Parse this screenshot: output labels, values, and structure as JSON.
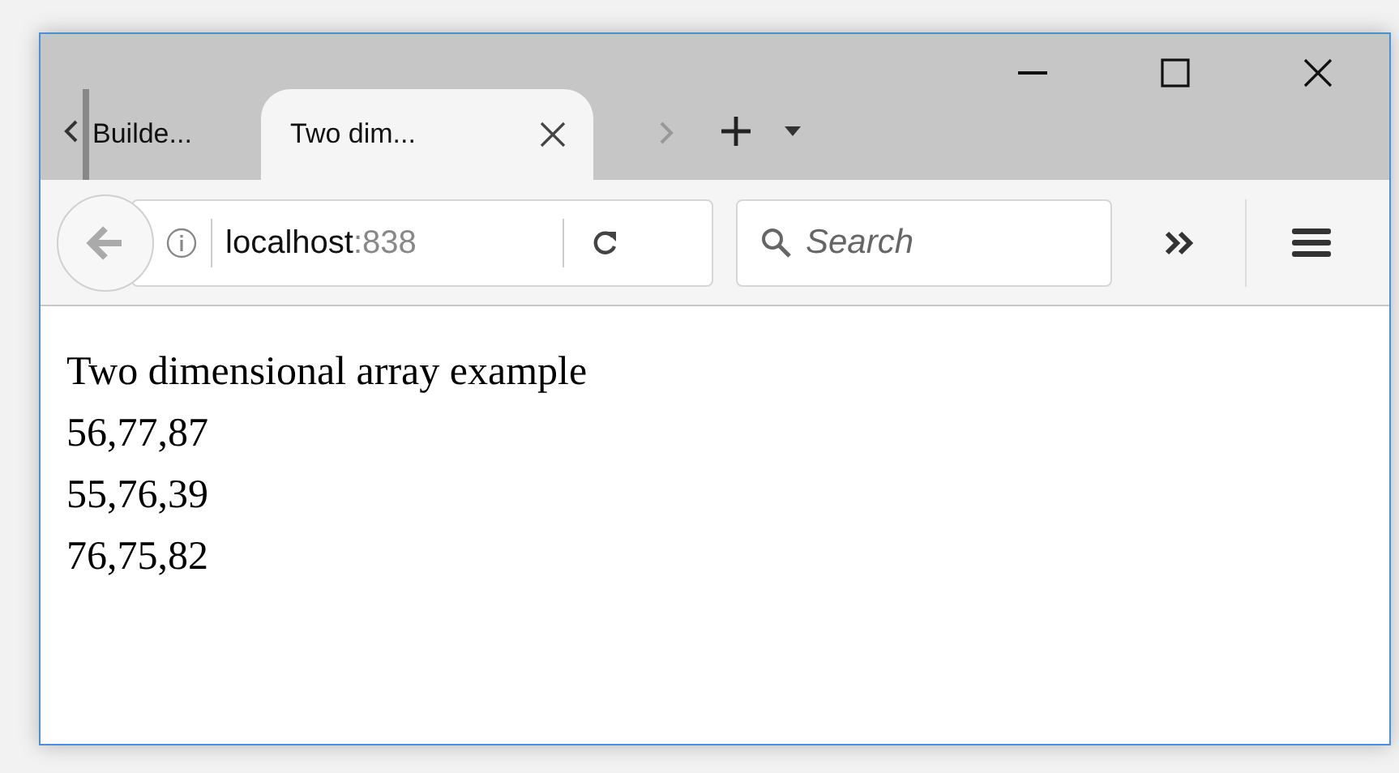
{
  "tabs": [
    {
      "title": "Builde...",
      "selected": false
    },
    {
      "title": "Two dim...",
      "selected": true
    }
  ],
  "address": {
    "host": "localhost",
    "rest": ":838"
  },
  "search": {
    "placeholder": "Search"
  },
  "page": {
    "lines": [
      "Two dimensional array example",
      "56,77,87",
      "55,76,39",
      "76,75,82"
    ]
  }
}
